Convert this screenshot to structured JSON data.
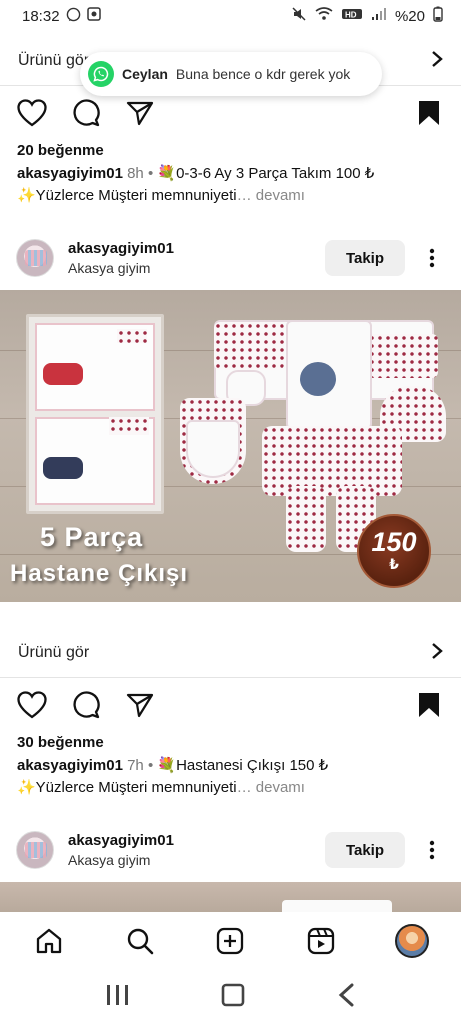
{
  "status_bar": {
    "time": "18:32",
    "battery": "%20"
  },
  "post1": {
    "product_link": "Ürünü gör",
    "likes": "20 beğenme",
    "caption": {
      "user": "akasyagiyim01",
      "time": "8h",
      "separator": "•",
      "text_line1": "💐0-3-6 Ay 3 Parça Takım 100 ₺",
      "text_line2": "✨Yüzlerce Müşteri memnuniyeti",
      "more": "… devamı"
    }
  },
  "notification": {
    "app_icon": "whatsapp-icon",
    "sender": "Ceylan",
    "message": "Buna bence o kdr gerek yok"
  },
  "post2": {
    "header": {
      "username": "akasyagiyim01",
      "subtitle": "Akasya giyim",
      "follow_label": "Takip"
    },
    "image": {
      "overlay_line1": "5 Parça",
      "overlay_line2": "Hastane Çıkışı",
      "price": "150",
      "currency": "₺"
    },
    "product_link": "Ürünü gör",
    "likes": "30 beğenme",
    "caption": {
      "user": "akasyagiyim01",
      "time": "7h",
      "separator": "•",
      "text_line1": "💐Hastanesi Çıkışı 150 ₺",
      "text_line2": "✨Yüzlerce Müşteri memnuniyeti",
      "more": "… devamı"
    }
  },
  "post3": {
    "header": {
      "username": "akasyagiyim01",
      "subtitle": "Akasya giyim",
      "follow_label": "Takip"
    }
  },
  "bottom_nav": [
    "home-icon",
    "search-icon",
    "create-icon",
    "reels-icon",
    "profile-avatar"
  ],
  "colors": {
    "whatsapp_green": "#25d366",
    "price_badge": "#6b2a14",
    "follow_button_bg": "#efefef"
  }
}
